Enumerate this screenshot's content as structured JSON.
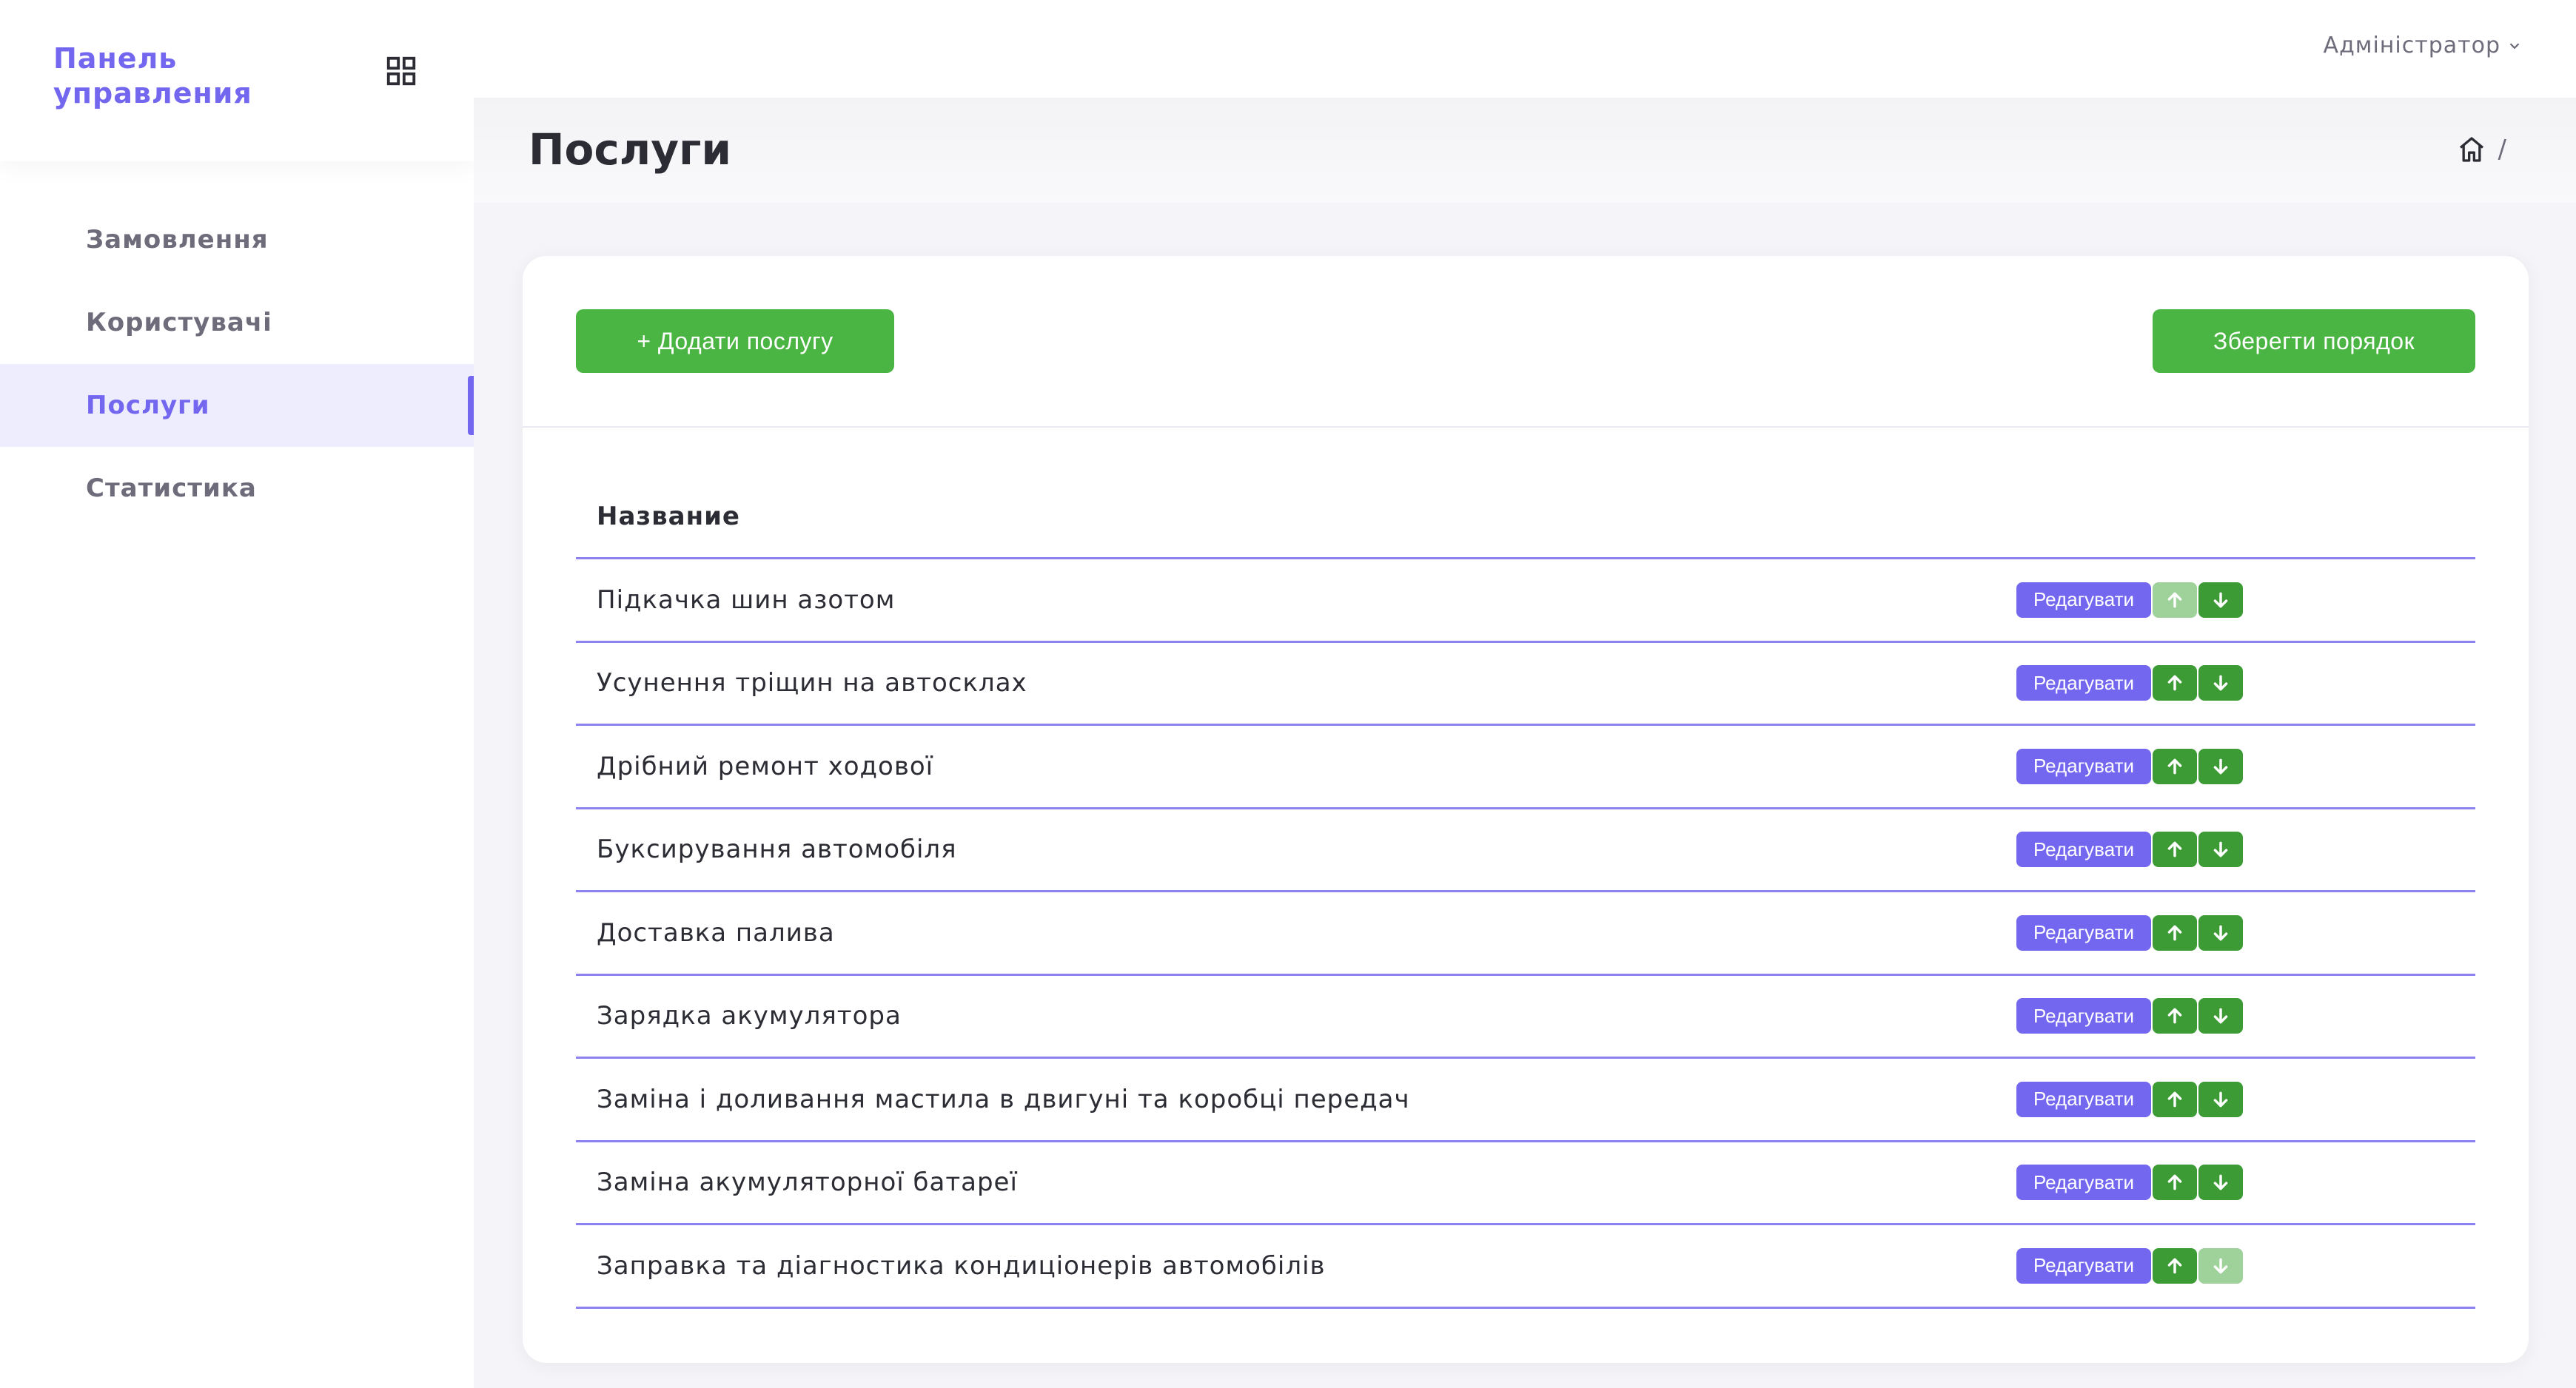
{
  "brand": {
    "title": "Панель\nуправления"
  },
  "sidebar": {
    "items": [
      {
        "label": "Замовлення",
        "active": false
      },
      {
        "label": "Користувачі",
        "active": false
      },
      {
        "label": "Послуги",
        "active": true
      },
      {
        "label": "Статистика",
        "active": false
      }
    ]
  },
  "topbar": {
    "user_menu": "Адміністратор"
  },
  "header": {
    "title": "Послуги",
    "breadcrumb_separator": "/"
  },
  "toolbar": {
    "add_label": "+ Додати послугу",
    "save_order_label": "Зберегти порядок"
  },
  "table": {
    "column_name": "Название",
    "edit_label": "Редагувати",
    "rows": [
      {
        "name": "Підкачка шин азотом",
        "up_enabled": false,
        "down_enabled": true
      },
      {
        "name": "Усунення тріщин на автосклах",
        "up_enabled": true,
        "down_enabled": true
      },
      {
        "name": "Дрібний ремонт ходової",
        "up_enabled": true,
        "down_enabled": true
      },
      {
        "name": "Буксирування автомобіля",
        "up_enabled": true,
        "down_enabled": true
      },
      {
        "name": "Доставка палива",
        "up_enabled": true,
        "down_enabled": true
      },
      {
        "name": "Зарядка акумулятора",
        "up_enabled": true,
        "down_enabled": true
      },
      {
        "name": "Заміна і доливання мастила в двигуні та коробці передач",
        "up_enabled": true,
        "down_enabled": true
      },
      {
        "name": "Заміна акумуляторної батареї",
        "up_enabled": true,
        "down_enabled": true
      },
      {
        "name": "Заправка та діагностика кондиціонерів автомобілів",
        "up_enabled": true,
        "down_enabled": false
      }
    ]
  },
  "colors": {
    "accent": "#7367f0",
    "success": "#4bb543",
    "success_dark": "#3d9b35",
    "success_disabled": "#9fd19a",
    "active_bg": "#eeedfd"
  },
  "icons": {
    "brand_toggle": "grid-icon",
    "breadcrumb_home": "home-icon",
    "user_menu_caret": "chevron-down-icon",
    "move_up": "arrow-up-icon",
    "move_down": "arrow-down-icon"
  }
}
